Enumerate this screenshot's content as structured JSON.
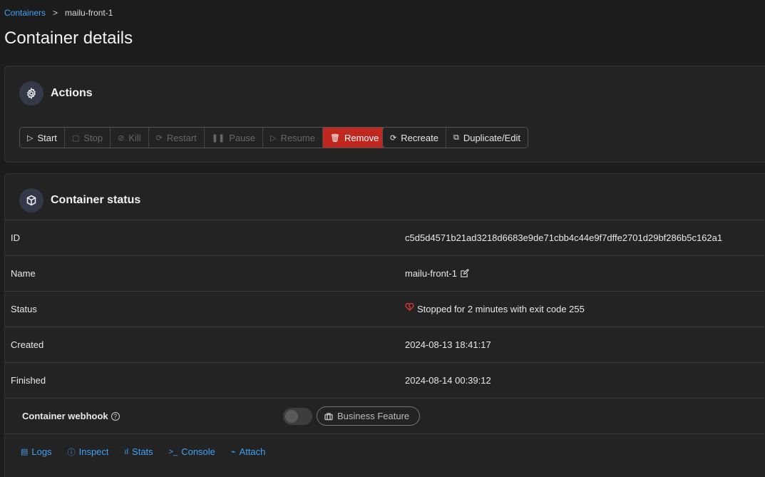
{
  "breadcrumb": {
    "root": "Containers",
    "separator": ">",
    "current": "mailu-front-1"
  },
  "page_title": "Container details",
  "actions": {
    "title": "Actions",
    "buttons": {
      "start": "Start",
      "stop": "Stop",
      "kill": "Kill",
      "restart": "Restart",
      "pause": "Pause",
      "resume": "Resume",
      "remove": "Remove",
      "recreate": "Recreate",
      "duplicate": "Duplicate/Edit"
    }
  },
  "status_panel": {
    "title": "Container status",
    "rows": {
      "id": {
        "label": "ID",
        "value": "c5d5d4571b21ad3218d6683e9de71cbb4c44e9f7dffe2701d29bf286b5c162a1"
      },
      "name": {
        "label": "Name",
        "value": "mailu-front-1"
      },
      "status": {
        "label": "Status",
        "value": "Stopped for 2 minutes with exit code 255"
      },
      "created": {
        "label": "Created",
        "value": "2024-08-13 18:41:17"
      },
      "finished": {
        "label": "Finished",
        "value": "2024-08-14 00:39:12"
      }
    },
    "webhook": {
      "label": "Container webhook",
      "enabled": false,
      "badge": "Business Feature"
    },
    "links": {
      "logs": "Logs",
      "inspect": "Inspect",
      "stats": "Stats",
      "console": "Console",
      "attach": "Attach"
    }
  },
  "colors": {
    "accent": "#3ea2f5",
    "danger": "#c0281f",
    "background": "#1c1c1c",
    "panel": "#232323"
  }
}
